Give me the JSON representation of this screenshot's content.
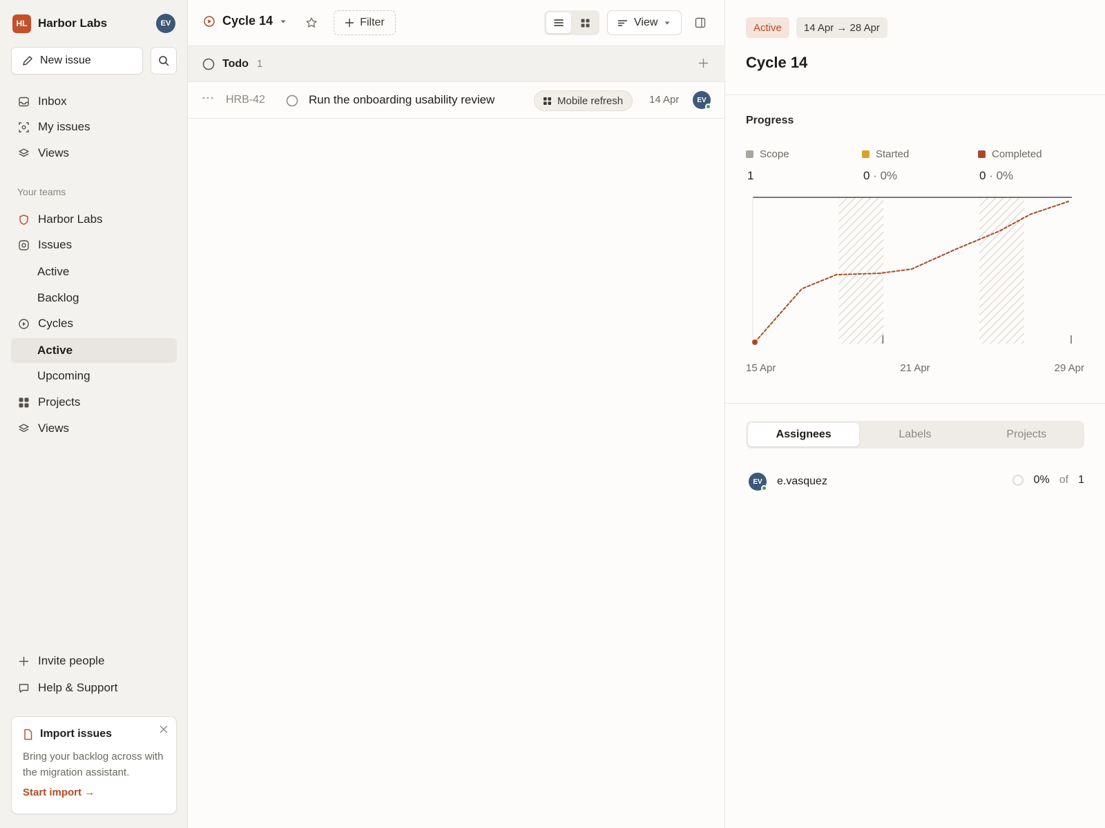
{
  "workspace": {
    "logo_initials": "HL",
    "name": "Harbor Labs",
    "user_initials": "EV"
  },
  "sidebar": {
    "new_issue_label": "New issue",
    "primary": [
      {
        "label": "Inbox",
        "icon": "inbox-icon"
      },
      {
        "label": "My issues",
        "icon": "target-icon"
      },
      {
        "label": "Views",
        "icon": "layers-icon"
      }
    ],
    "section_label": "Your teams",
    "team": {
      "name": "Harbor Labs",
      "issues_label": "Issues",
      "issues_active": "Active",
      "issues_backlog": "Backlog",
      "cycles_label": "Cycles",
      "cycles_active": "Active",
      "cycles_upcoming": "Upcoming",
      "projects_label": "Projects",
      "views_label": "Views"
    },
    "invite_label": "Invite people",
    "help_label": "Help & Support",
    "import_card": {
      "title": "Import issues",
      "body": "Bring your backlog across with the migration assistant.",
      "link": "Start import →"
    }
  },
  "toolbar": {
    "cycle_name": "Cycle 14",
    "filter_label": "Filter",
    "view_label": "View"
  },
  "group": {
    "title": "Todo",
    "count": "1"
  },
  "issues": [
    {
      "id": "HRB-42",
      "title": "Run the onboarding usability review",
      "project": "Mobile refresh",
      "date": "14 Apr",
      "assignee_initials": "EV"
    }
  ],
  "panel": {
    "status": "Active",
    "date_range": "14 Apr → 28 Apr",
    "title": "Cycle 14",
    "progress_label": "Progress",
    "stats": [
      {
        "label": "Scope",
        "value": "1",
        "pct": "",
        "color": "#a9a59f"
      },
      {
        "label": "Started",
        "value": "0",
        "pct": " · 0%",
        "color": "#d9a12c"
      },
      {
        "label": "Completed",
        "value": "0",
        "pct": " · 0%",
        "color": "#a84a26"
      }
    ],
    "tabs": [
      "Assignees",
      "Labels",
      "Projects"
    ],
    "assignee": {
      "initials": "EV",
      "name": "e.vasquez",
      "pct": "0%",
      "of": "of",
      "total": "1"
    }
  },
  "chart_data": {
    "type": "line",
    "x_ticks": [
      "15 Apr",
      "21 Apr",
      "29 Apr"
    ],
    "series": [
      {
        "values": [
          0,
          0.38,
          0.48,
          0.49,
          0.52,
          0.66,
          0.79,
          0.91,
          0.97,
          1.0
        ]
      }
    ],
    "scope": 1,
    "weekend_bands": 2,
    "colors": {
      "projection": "#a84a26",
      "scope_line": "#2b2824"
    }
  }
}
